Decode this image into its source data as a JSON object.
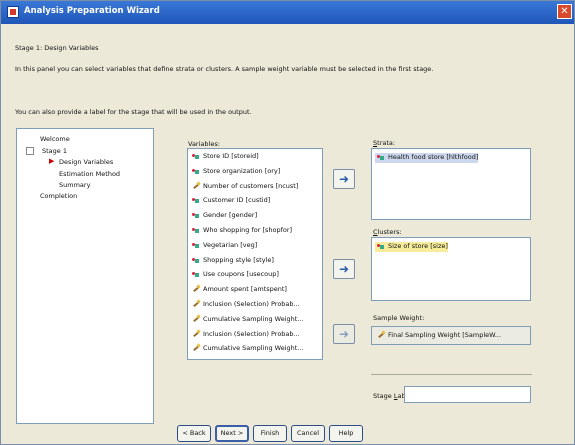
{
  "window": {
    "title": "Analysis Preparation Wizard",
    "close_glyph": "✕"
  },
  "header": {
    "stage": "Stage 1: Design Variables",
    "description": "In this panel you can select variables that define strata or clusters. A sample weight variable must be selected in the first stage.",
    "label_hint": "You can also provide a label for the stage that will be used in the output."
  },
  "tree": {
    "welcome": "Welcome",
    "stage1": "Stage 1",
    "design_variables": "Design Variables",
    "estimation_method": "Estimation Method",
    "summary": "Summary",
    "completion": "Completion",
    "selected_marker": "▶"
  },
  "variables": {
    "label": "Variables:",
    "items": [
      {
        "label": "Store ID [storeid]",
        "icon": "nominal"
      },
      {
        "label": "Store organization [ory]",
        "icon": "nominal"
      },
      {
        "label": "Number of customers [ncust]",
        "icon": "scale"
      },
      {
        "label": "Customer ID [custid]",
        "icon": "nominal"
      },
      {
        "label": "Gender [gender]",
        "icon": "nominal"
      },
      {
        "label": "Who shopping for [shopfor]",
        "icon": "nominal"
      },
      {
        "label": "Vegetarian [veg]",
        "icon": "nominal"
      },
      {
        "label": "Shopping style [style]",
        "icon": "nominal"
      },
      {
        "label": "Use coupons [usecoup]",
        "icon": "nominal"
      },
      {
        "label": "Amount spent [amtspent]",
        "icon": "scale"
      },
      {
        "label": "Inclusion (Selection) Probab...",
        "icon": "scale"
      },
      {
        "label": "Cumulative Sampling Weight...",
        "icon": "scale"
      },
      {
        "label": "Inclusion (Selection) Probab...",
        "icon": "scale"
      },
      {
        "label": "Cumulative Sampling Weight...",
        "icon": "scale"
      }
    ]
  },
  "arrows": {
    "strata": "➜",
    "clusters": "➜",
    "weight": "➜"
  },
  "strata": {
    "label_prefix": "S",
    "label_rest": "trata:",
    "items": [
      "Health food store [hlthfood]"
    ]
  },
  "clusters": {
    "label_prefix": "C",
    "label_rest": "lusters:",
    "items": [
      "Size of store [size]"
    ]
  },
  "sample_weight": {
    "label": "Sample Weight:",
    "value": "Final Sampling Weight [SampleW..."
  },
  "stage_label": {
    "label_a": "Stage ",
    "label_u": "L",
    "label_b": "abel:",
    "value": ""
  },
  "buttons": {
    "back": "< Back",
    "next": "Next >",
    "finish": "Finish",
    "cancel": "Cancel",
    "help": "Help"
  },
  "colors": {
    "title_bar": "#1f56b8",
    "dialog_bg": "#ece9d8",
    "strata_highlight": "#cdd8ee",
    "cluster_highlight": "#f6ec9a"
  }
}
